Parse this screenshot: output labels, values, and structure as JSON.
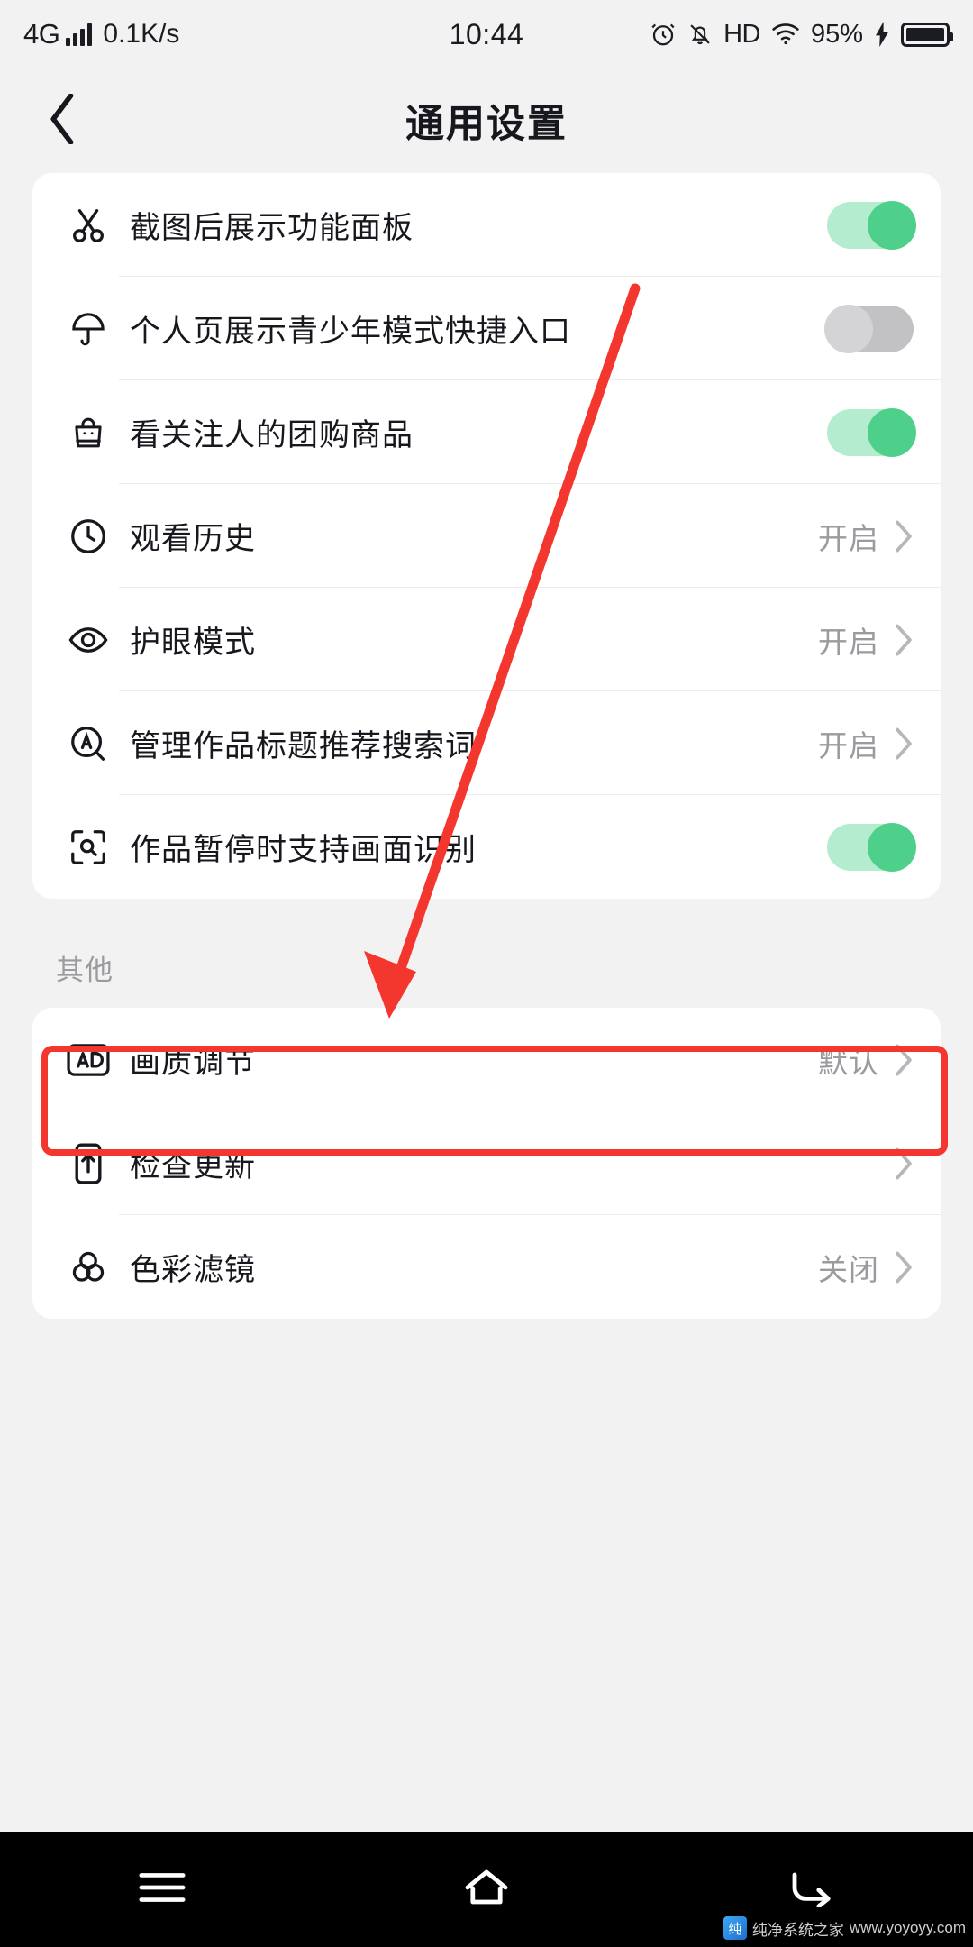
{
  "status_bar": {
    "network": "4G",
    "speed": "0.1K/s",
    "time": "10:44",
    "hd": "HD",
    "battery_percent": "95%",
    "icons": [
      "signal-bars-icon",
      "alarm-clock-icon",
      "mute-bell-icon",
      "hd-icon",
      "wifi-icon",
      "charging-bolt-icon",
      "battery-icon"
    ]
  },
  "header": {
    "back_icon": "chevron-left-icon",
    "title": "通用设置"
  },
  "card_main": {
    "rows": [
      {
        "icon": "scissors-icon",
        "label": "截图后展示功能面板",
        "control": "switch",
        "state": "on"
      },
      {
        "icon": "umbrella-icon",
        "label": "个人页展示青少年模式快捷入口",
        "control": "switch",
        "state": "off"
      },
      {
        "icon": "shopping-bag-icon",
        "label": "看关注人的团购商品",
        "control": "switch",
        "state": "on"
      },
      {
        "icon": "clock-icon",
        "label": "观看历史",
        "control": "value",
        "value": "开启"
      },
      {
        "icon": "eye-icon",
        "label": "护眼模式",
        "control": "value",
        "value": "开启"
      },
      {
        "icon": "a-circle-icon",
        "label": "管理作品标题推荐搜索词",
        "control": "value",
        "value": "开启"
      },
      {
        "icon": "scan-search-icon",
        "label": "作品暂停时支持画面识别",
        "control": "switch",
        "state": "on"
      }
    ]
  },
  "section_other": {
    "label": "其他"
  },
  "card_other": {
    "rows": [
      {
        "icon": "ad-box-icon",
        "label": "画质调节",
        "control": "value",
        "value": "默认",
        "highlighted": false
      },
      {
        "icon": "phone-up-icon",
        "label": "检查更新",
        "control": "value",
        "value": "",
        "highlighted": true
      },
      {
        "icon": "color-rings-icon",
        "label": "色彩滤镜",
        "control": "value",
        "value": "关闭",
        "highlighted": false
      }
    ]
  },
  "annotation": {
    "type": "arrow",
    "color": "#f4372e",
    "from_label": "个人页展示青少年模式快捷入口开关",
    "to_label": "检查更新"
  },
  "nav_bar": {
    "items": [
      {
        "icon": "menu-recents-icon",
        "label": "最近任务"
      },
      {
        "icon": "home-icon",
        "label": "主页"
      },
      {
        "icon": "back-arrow-icon",
        "label": "返回"
      }
    ]
  },
  "watermark": {
    "text": "纯净系统之家",
    "url": "www.yoyoyy.com"
  },
  "colors": {
    "accent_green": "#4ed08a",
    "track_green": "#b3ecce",
    "track_gray": "#c2c2c4",
    "annotation_red": "#f4372e",
    "page_bg": "#f2f2f2",
    "card_bg": "#ffffff",
    "text_primary": "#17171e",
    "text_secondary": "#9a9a9f"
  }
}
